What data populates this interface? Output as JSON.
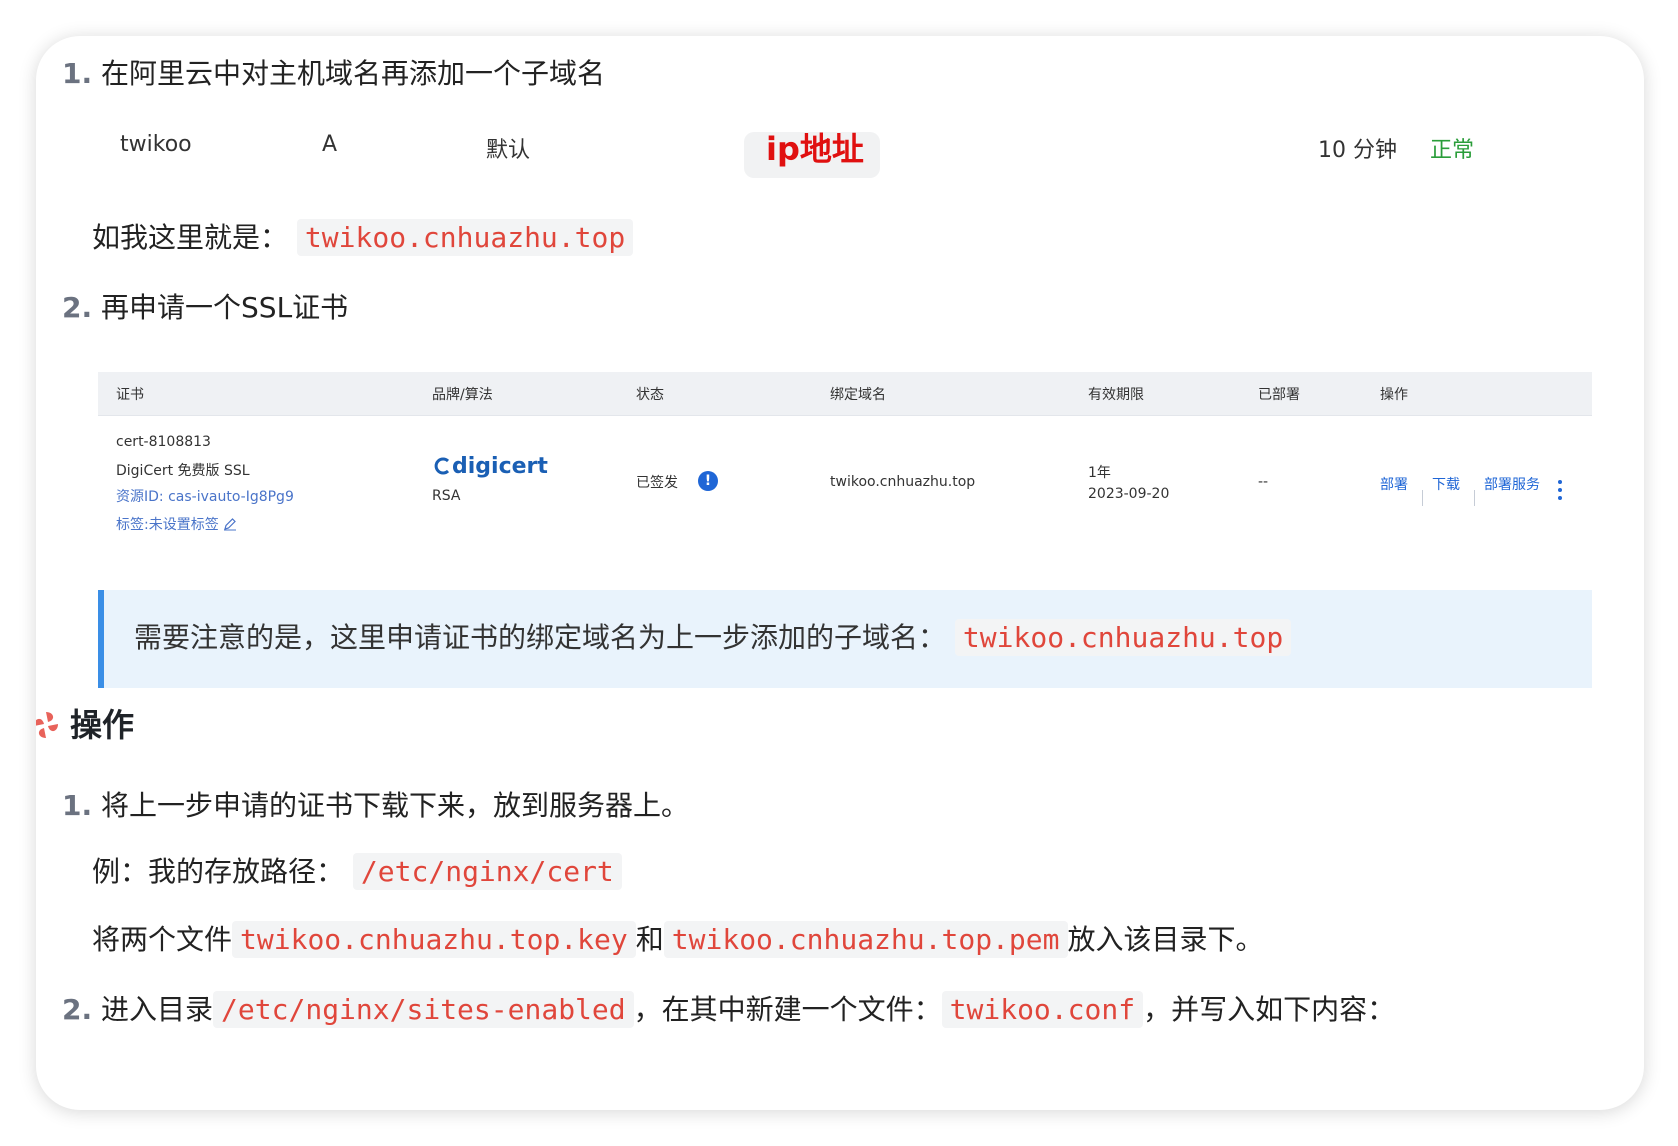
{
  "step1": {
    "num": "1.",
    "text": "在阿里云中对主机域名再添加一个子域名"
  },
  "dns_record": {
    "host": "twikoo",
    "type": "A",
    "line": "默认",
    "value": "ip地址",
    "ttl": "10 分钟",
    "status": "正常",
    "status_color": "#2a9d3a"
  },
  "example": {
    "prefix": "如我这里就是：",
    "code": "twikoo.cnhuazhu.top"
  },
  "step2": {
    "num": "2.",
    "text": "再申请一个SSL证书"
  },
  "cert_table": {
    "headers": [
      "证书",
      "品牌/算法",
      "状态",
      "绑定域名",
      "有效期限",
      "已部署",
      "操作"
    ],
    "row": {
      "cert_id": "cert-8108813",
      "cert_name": "DigiCert 免费版 SSL",
      "resource_id": "资源ID: cas-ivauto-Ig8Pg9",
      "tag": "标签:未设置标签",
      "brand": "digicert",
      "algorithm": "RSA",
      "state": "已签发",
      "state_icon": "!",
      "domain": "twikoo.cnhuazhu.top",
      "validity_period": "1年",
      "validity_date": "2023-09-20",
      "deployed": "--",
      "actions": [
        "部署",
        "下载",
        "部署服务"
      ]
    }
  },
  "callout": {
    "text": "需要注意的是，这里申请证书的绑定域名为上一步添加的子域名：",
    "code": "twikoo.cnhuazhu.top"
  },
  "section": {
    "title": "操作"
  },
  "ops": {
    "step1": {
      "num": "1.",
      "text": "将上一步申请的证书下载下来，放到服务器上。"
    },
    "path_line": {
      "prefix": "例：我的存放路径：",
      "code": "/etc/nginx/cert"
    },
    "files_line": {
      "prefix": "将两个文件",
      "file1": "twikoo.cnhuazhu.top.key",
      "mid": "和",
      "file2": "twikoo.cnhuazhu.top.pem",
      "suffix": "放入该目录下。"
    },
    "step2": {
      "num": "2.",
      "prefix": "进入目录",
      "dir": "/etc/nginx/sites-enabled",
      "mid": "，在其中新建一个文件：",
      "file": "twikoo.conf",
      "suffix": "，并写入如下内容："
    }
  }
}
